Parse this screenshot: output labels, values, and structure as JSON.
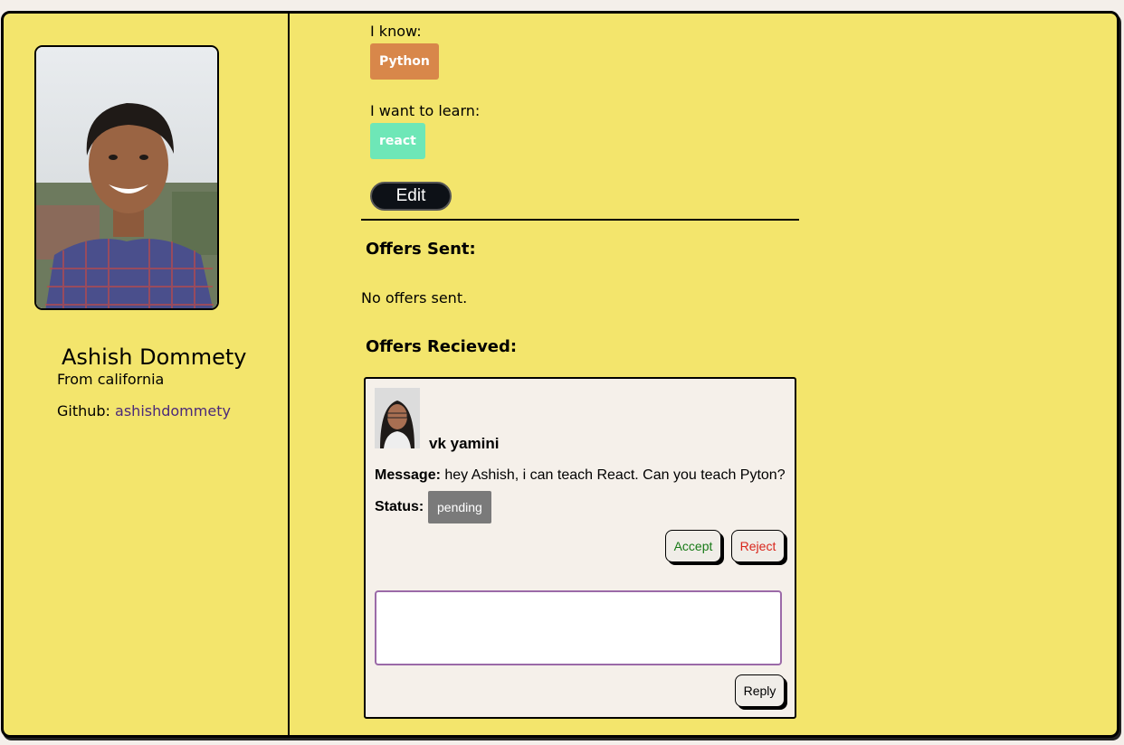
{
  "profile": {
    "name": "Ashish Dommety",
    "from": "From california",
    "github_label": "Github: ",
    "github_handle": "ashishdommety"
  },
  "skills": {
    "know_label": "I know:",
    "know": [
      "Python"
    ],
    "learn_label": "I want to learn:",
    "learn": [
      "react"
    ],
    "edit_label": "Edit"
  },
  "offers_sent": {
    "title": "Offers Sent:",
    "empty_text": "No offers sent."
  },
  "offers_received": {
    "title": "Offers Recieved:",
    "items": [
      {
        "sender": "vk yamini",
        "message_label": "Message:",
        "message": " hey Ashish, i can teach React. Can you teach Pyton?",
        "status_label": "Status:",
        "status": "pending",
        "accept_label": "Accept",
        "reject_label": "Reject",
        "reply_value": "",
        "reply_label": "Reply"
      }
    ]
  },
  "colors": {
    "background": "#f3e56c",
    "python_chip": "#d8874a",
    "react_chip": "#6ee7b7",
    "pending_badge": "#7a7a7a",
    "accept_text": "#177a17",
    "reject_text": "#d9251b",
    "github_link": "#4b2a7a"
  }
}
